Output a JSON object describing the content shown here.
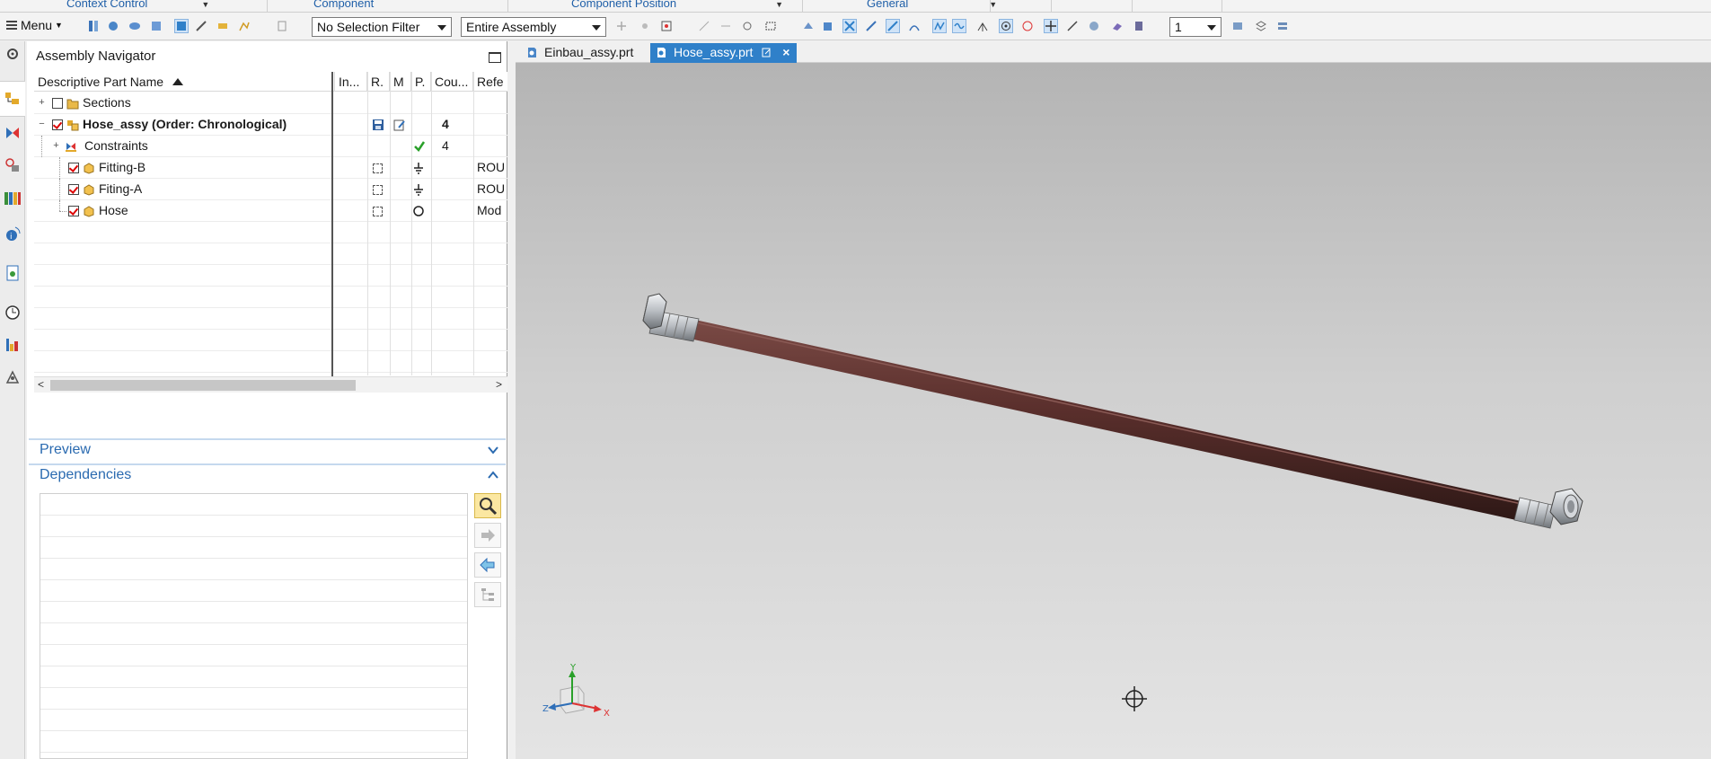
{
  "ribbon_groups": [
    {
      "label": "Context Control"
    },
    {
      "label": "Component"
    },
    {
      "label": "Component Position"
    },
    {
      "label": "General"
    }
  ],
  "toolbar": {
    "menu_label": "Menu",
    "selection_filter": "No Selection Filter",
    "scope": "Entire Assembly",
    "layer_value": "1"
  },
  "navigator": {
    "title": "Assembly Navigator",
    "columns": [
      "Descriptive Part Name",
      "In...",
      "R.",
      "M",
      "P.",
      "Cou...",
      "Refe"
    ],
    "rows": [
      {
        "name": "Sections",
        "count": "",
        "ref": "",
        "bold": false
      },
      {
        "name": "Hose_assy (Order: Chronological)",
        "count": "4",
        "ref": "",
        "bold": true
      },
      {
        "name": "Constraints",
        "count": "4",
        "ref": "",
        "bold": false
      },
      {
        "name": "Fitting-B",
        "count": "",
        "ref": "ROU",
        "bold": false
      },
      {
        "name": "Fiting-A",
        "count": "",
        "ref": "ROU",
        "bold": false
      },
      {
        "name": "Hose",
        "count": "",
        "ref": "Mod",
        "bold": false
      }
    ]
  },
  "preview": {
    "title": "Preview"
  },
  "dependencies": {
    "title": "Dependencies"
  },
  "tabs": [
    {
      "label": "Einbau_assy.prt",
      "active": false
    },
    {
      "label": "Hose_assy.prt",
      "active": true
    }
  ],
  "triad": {
    "x_label": "X",
    "y_label": "Y",
    "z_label": "Z"
  },
  "colors": {
    "accent": "#2f80c9",
    "hose": "#5a2f2c",
    "fitting": "#c9ccd0",
    "check_red": "#d00000",
    "constraint_green": "#2aa02a"
  }
}
